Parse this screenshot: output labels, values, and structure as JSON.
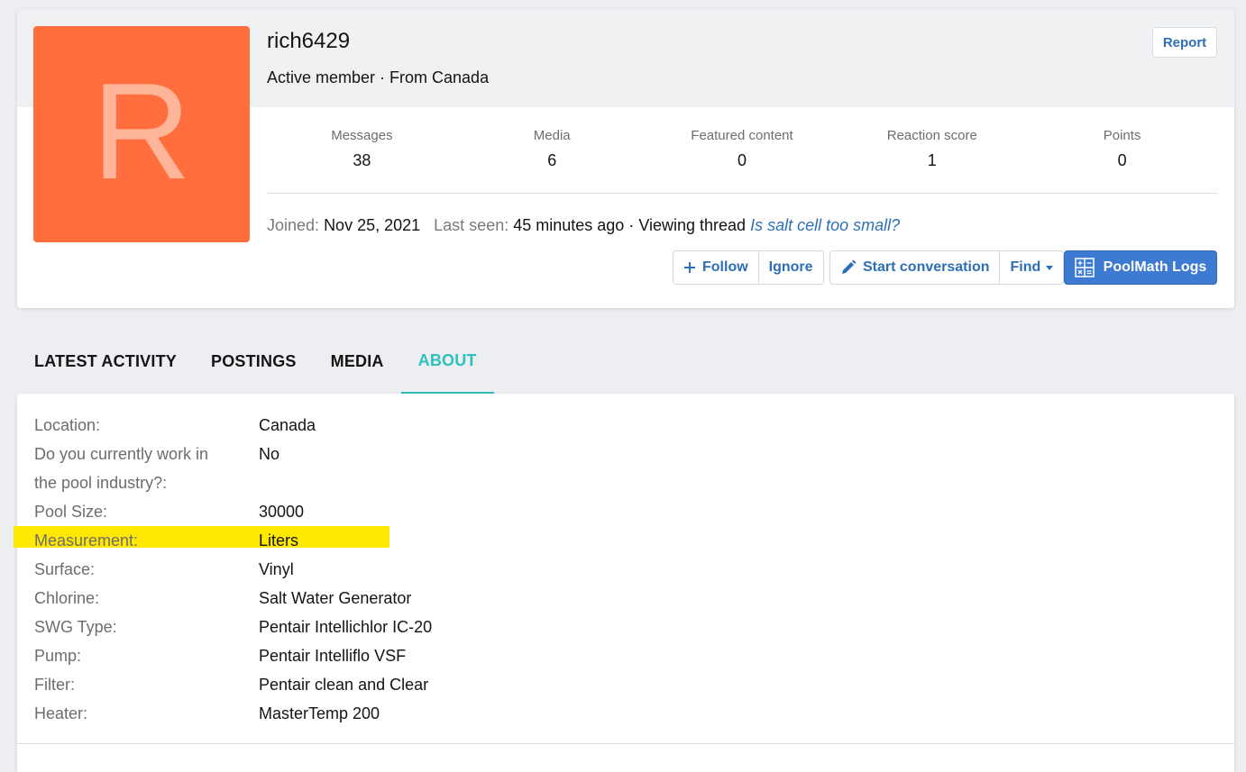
{
  "profile": {
    "avatar_letter": "R",
    "username": "rich6429",
    "blurb": "Active member · From Canada",
    "report_label": "Report",
    "stats": [
      {
        "label": "Messages",
        "value": "38"
      },
      {
        "label": "Media",
        "value": "6"
      },
      {
        "label": "Featured content",
        "value": "0"
      },
      {
        "label": "Reaction score",
        "value": "1"
      },
      {
        "label": "Points",
        "value": "0"
      }
    ],
    "joined_label": "Joined:",
    "joined_value": "Nov 25, 2021",
    "last_seen_label": "Last seen:",
    "last_seen_value": "45 minutes ago · Viewing thread",
    "thread_link": "Is salt cell too small?",
    "buttons": {
      "follow": "Follow",
      "ignore": "Ignore",
      "start_conversation": "Start conversation",
      "find": "Find",
      "poolmath": "PoolMath Logs"
    }
  },
  "tabs": [
    {
      "label": "LATEST ACTIVITY",
      "active": false
    },
    {
      "label": "POSTINGS",
      "active": false
    },
    {
      "label": "MEDIA",
      "active": false
    },
    {
      "label": "ABOUT",
      "active": true
    }
  ],
  "about": [
    {
      "key": "Location:",
      "value": "Canada"
    },
    {
      "key": "Do you currently work in",
      "value": "No"
    },
    {
      "key": "the pool industry?:",
      "value": ""
    },
    {
      "key": "Pool Size:",
      "value": "30000"
    },
    {
      "key": "Measurement:",
      "value": "Liters"
    },
    {
      "key": "Surface:",
      "value": "Vinyl"
    },
    {
      "key": "Chlorine:",
      "value": "Salt Water Generator"
    },
    {
      "key": "SWG Type:",
      "value": "Pentair Intellichlor IC-20"
    },
    {
      "key": "Pump:",
      "value": "Pentair Intelliflo VSF"
    },
    {
      "key": "Filter:",
      "value": "Pentair clean and Clear"
    },
    {
      "key": "Heater:",
      "value": "MasterTemp 200"
    }
  ],
  "colors": {
    "accent": "#2fc0bd",
    "link": "#2c6fb7",
    "avatar_bg": "#ff6e3c",
    "primary_button": "#3d7ad2",
    "highlight": "#ffe900"
  }
}
